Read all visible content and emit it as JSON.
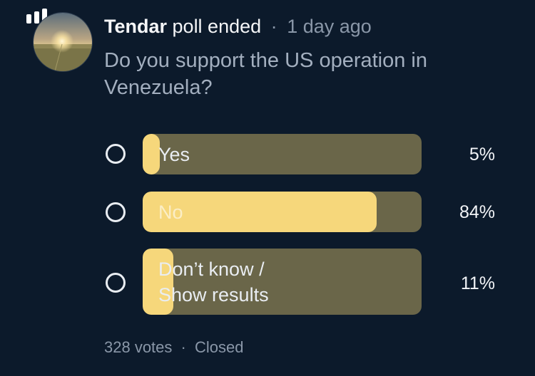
{
  "poll": {
    "author": "Tendar",
    "header_text": "poll ended",
    "separator": "·",
    "time": "1 day ago",
    "question": "Do you support the US operation in Venezuela?",
    "options": [
      {
        "label": "Yes",
        "percent_text": "5%",
        "percent": 5
      },
      {
        "label": "No",
        "percent_text": "84%",
        "percent": 84
      },
      {
        "label": "Don’t know /\nShow results",
        "percent_text": "11%",
        "percent": 11
      }
    ],
    "votes": "328 votes",
    "status": "Closed"
  },
  "colors": {
    "background": "#0c1a2b",
    "bar_track": "#6a6649",
    "bar_fill": "#f6d77b",
    "muted_text": "#8a97a8"
  },
  "icons": {
    "poll": "bar-chart-icon",
    "radio": "radio-circle-icon"
  }
}
